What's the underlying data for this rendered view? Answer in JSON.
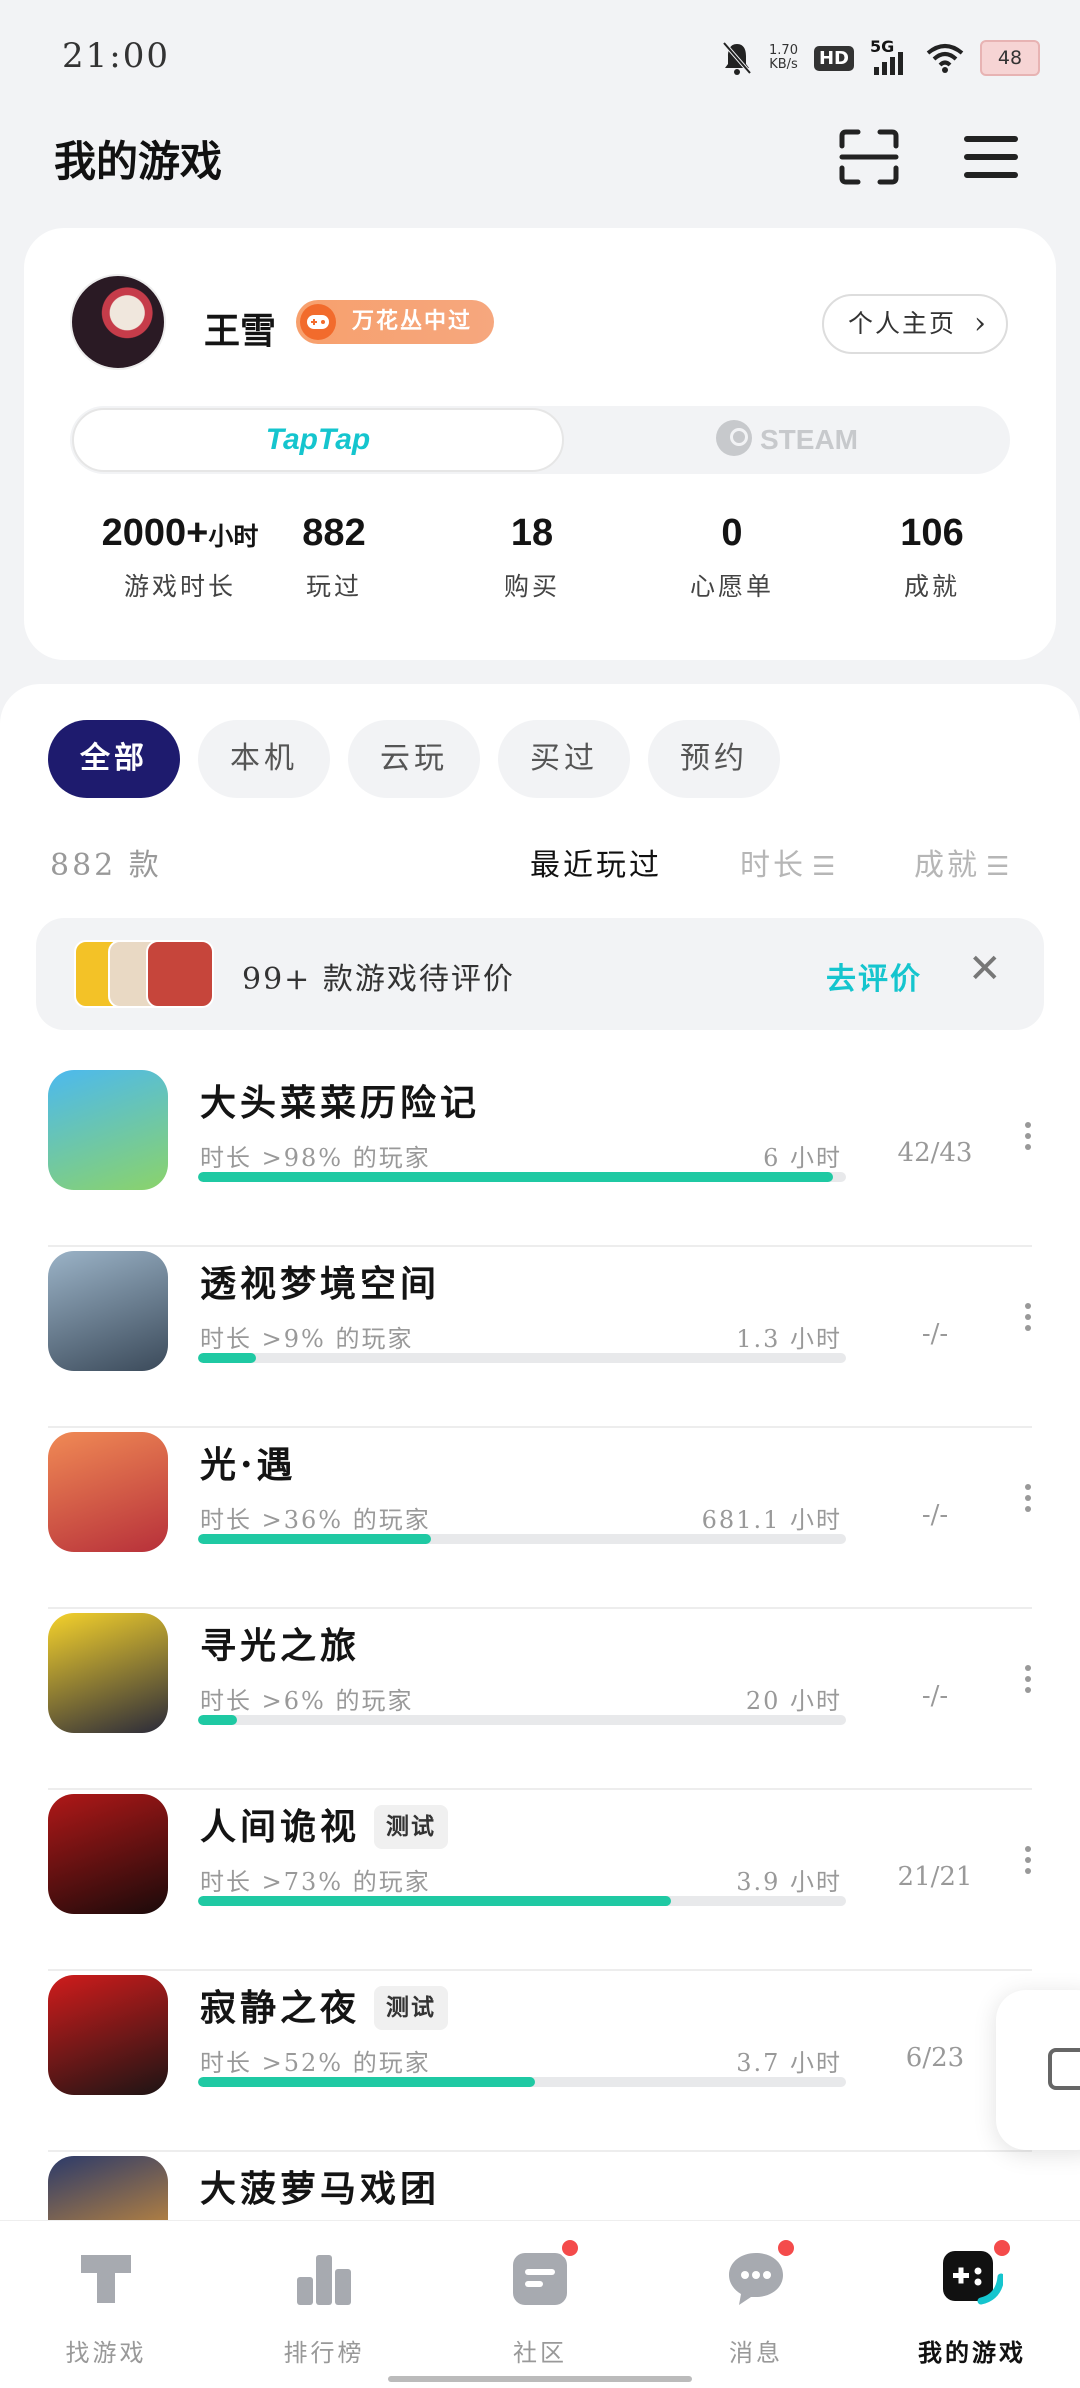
{
  "status_bar": {
    "time": "21:00",
    "net_speed_value": "1.70",
    "net_speed_unit": "KB/s",
    "hd_label": "HD",
    "signal_label": "5G",
    "battery": "48"
  },
  "header": {
    "title": "我的游戏"
  },
  "profile": {
    "name": "王雪",
    "badge": "万花丛中过",
    "home_button": "个人主页",
    "platforms": {
      "taptap": "TapTap",
      "steam": "STEAM"
    },
    "stats": [
      {
        "value": "2000+",
        "unit": "小时",
        "label": "游戏时长"
      },
      {
        "value": "882",
        "unit": "",
        "label": "玩过"
      },
      {
        "value": "18",
        "unit": "",
        "label": "购买"
      },
      {
        "value": "0",
        "unit": "",
        "label": "心愿单"
      },
      {
        "value": "106",
        "unit": "",
        "label": "成就"
      }
    ]
  },
  "filters": [
    "全部",
    "本机",
    "云玩",
    "买过",
    "预约"
  ],
  "list_meta": {
    "count": "882 款",
    "sort_recent": "最近玩过",
    "sort_duration": "时长",
    "sort_achievement": "成就"
  },
  "review_banner": {
    "text": "99+ 款游戏待评价",
    "action": "去评价",
    "close": "✕",
    "thumb_colors": [
      "#f3c227",
      "#e9d9c4",
      "#c6453b"
    ]
  },
  "games": [
    {
      "name": "大头菜菜历险记",
      "tag": "",
      "sub": "时长 >98% 的玩家",
      "hours": "6 小时",
      "achievement": "42/43",
      "progress": 0.98,
      "icon_colors": [
        "#4cb9ef",
        "#8bd36a"
      ]
    },
    {
      "name": "透视梦境空间",
      "tag": "",
      "sub": "时长 >9% 的玩家",
      "hours": "1.3 小时",
      "achievement": "-/-",
      "progress": 0.09,
      "icon_colors": [
        "#9bb3c7",
        "#3b4a5a"
      ]
    },
    {
      "name": "光·遇",
      "tag": "",
      "sub": "时长 >36% 的玩家",
      "hours": "681.1 小时",
      "achievement": "-/-",
      "progress": 0.36,
      "icon_colors": [
        "#f08a55",
        "#b7303a"
      ]
    },
    {
      "name": "寻光之旅",
      "tag": "",
      "sub": "时长 >6% 的玩家",
      "hours": "20 小时",
      "achievement": "-/-",
      "progress": 0.06,
      "icon_colors": [
        "#f5d22b",
        "#2a2a3a"
      ]
    },
    {
      "name": "人间诡视",
      "tag": "测试",
      "sub": "时长 >73% 的玩家",
      "hours": "3.9 小时",
      "achievement": "21/21",
      "progress": 0.73,
      "icon_colors": [
        "#b01818",
        "#1a0a0a"
      ]
    },
    {
      "name": "寂静之夜",
      "tag": "测试",
      "sub": "时长 >52% 的玩家",
      "hours": "3.7 小时",
      "achievement": "6/23",
      "progress": 0.52,
      "icon_colors": [
        "#d01c1c",
        "#1c1414"
      ]
    },
    {
      "name": "大菠萝马戏团",
      "tag": "",
      "sub": "",
      "hours": "",
      "achievement": "",
      "progress": null,
      "icon_colors": [
        "#2b3a6a",
        "#f0a030"
      ]
    }
  ],
  "bottom_nav": [
    {
      "label": "找游戏",
      "icon": "find-games-icon",
      "dot": false,
      "active": false
    },
    {
      "label": "排行榜",
      "icon": "leaderboard-icon",
      "dot": false,
      "active": false
    },
    {
      "label": "社区",
      "icon": "community-icon",
      "dot": true,
      "active": false
    },
    {
      "label": "消息",
      "icon": "messages-icon",
      "dot": true,
      "active": false
    },
    {
      "label": "我的游戏",
      "icon": "my-games-icon",
      "dot": true,
      "active": true
    }
  ],
  "colors": {
    "accent": "#15c5ce",
    "progress": "#1fc9a3",
    "chip_active": "#1e1b6e",
    "badge": "#f7a06d",
    "dot": "#f44b4b"
  }
}
